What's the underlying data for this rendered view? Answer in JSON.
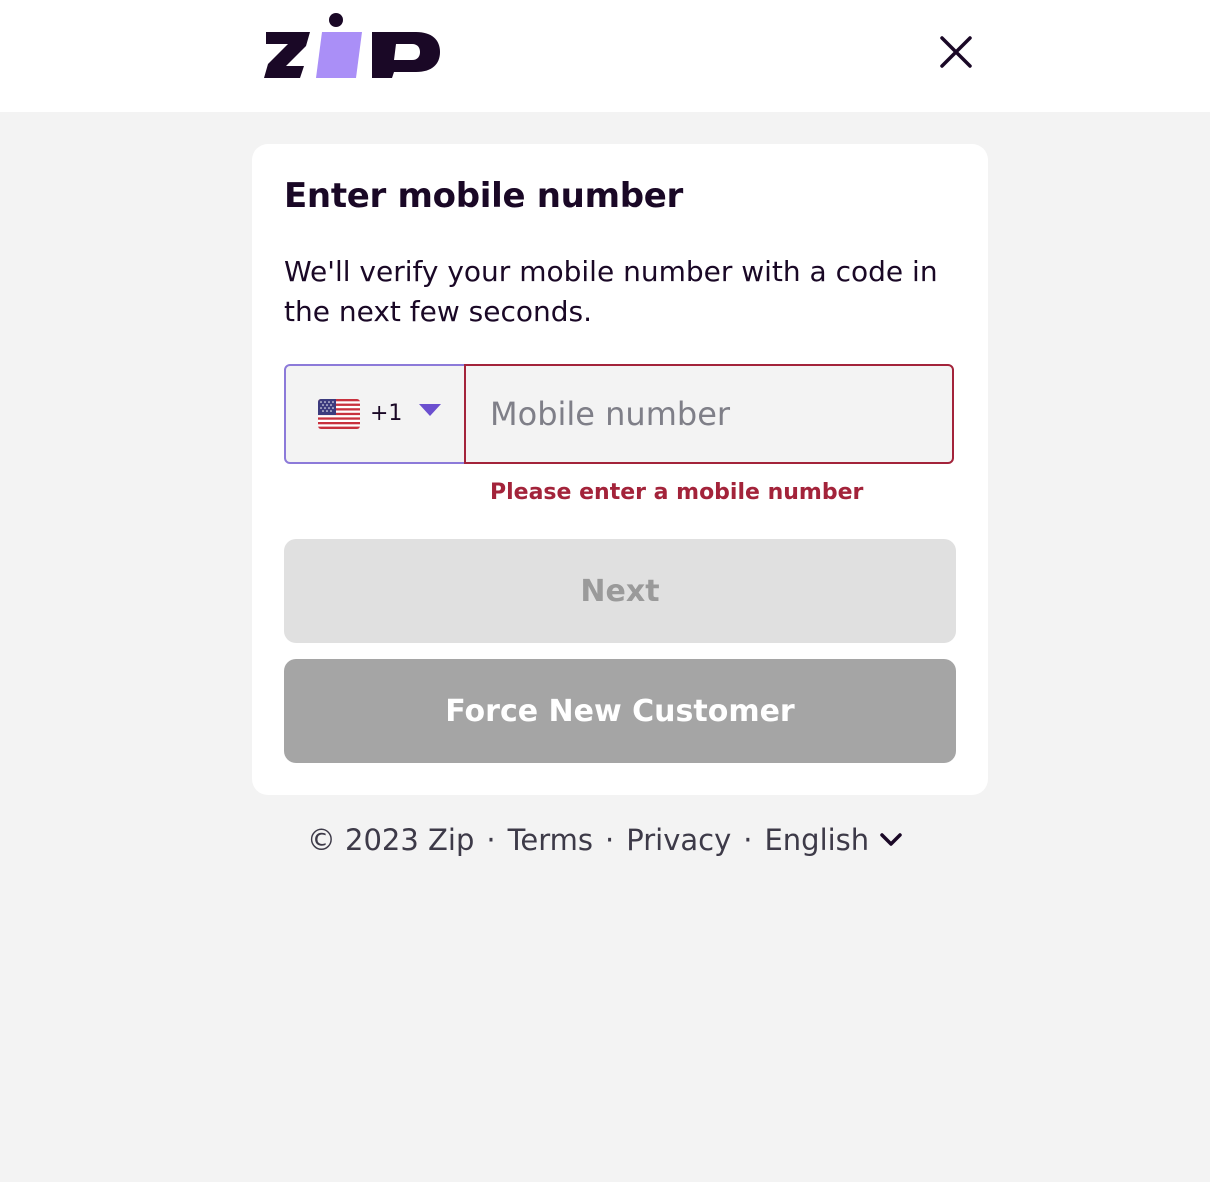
{
  "header": {
    "logo_alt": "zip",
    "close_icon": "close-icon"
  },
  "card": {
    "title": "Enter mobile number",
    "subtitle": "We'll verify your mobile number with a code in the next few seconds.",
    "phone": {
      "country_flag": "us-flag-icon",
      "dial_code": "+1",
      "caret_icon": "caret-down-icon",
      "value": "",
      "placeholder": "Mobile number",
      "error": "Please enter a mobile number"
    },
    "next_button": "Next",
    "force_button": "Force New Customer"
  },
  "footer": {
    "copyright": "© 2023 Zip",
    "separator": "·",
    "terms": "Terms",
    "privacy": "Privacy",
    "language": "English",
    "language_icon": "chevron-down-icon"
  },
  "colors": {
    "brand_dark": "#1a0826",
    "brand_purple": "#aa8ff7",
    "error": "#a3233a",
    "select_border": "#8c7ad9",
    "disabled_button": "#e0e0e0",
    "secondary_button": "#a5a5a5",
    "page_background": "#f3f3f3"
  }
}
